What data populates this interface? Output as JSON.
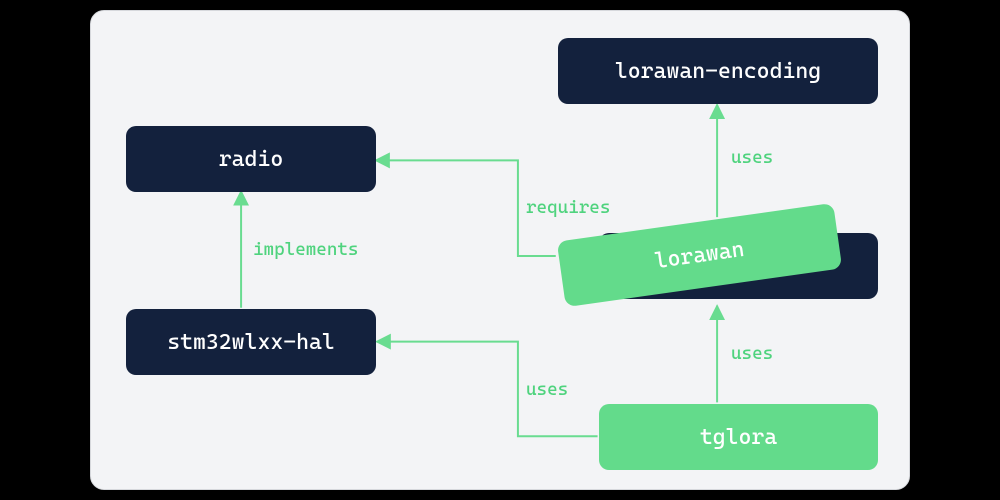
{
  "diagram": {
    "nodes": {
      "radio": {
        "label": "radio"
      },
      "lorawan_encoding": {
        "label": "lorawan-encoding"
      },
      "stm32": {
        "label": "stm32wlxx-hal"
      },
      "lorawan_dark": {
        "label": ""
      },
      "lorawan": {
        "label": "lorawan"
      },
      "tglora": {
        "label": "tglora"
      }
    },
    "edges": {
      "implements": {
        "label": "implements"
      },
      "requires": {
        "label": "requires"
      },
      "uses_encoding": {
        "label": "uses"
      },
      "uses_hal": {
        "label": "uses"
      },
      "uses_lorawan": {
        "label": "uses"
      }
    }
  }
}
